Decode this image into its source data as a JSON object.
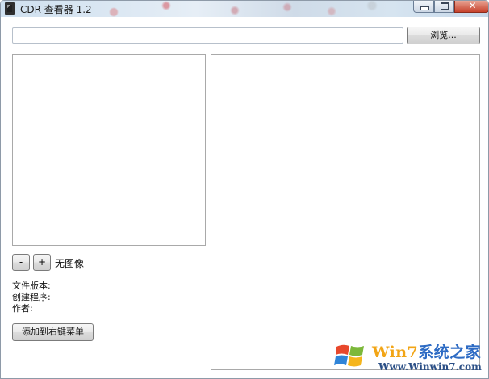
{
  "window": {
    "title": "CDR 查看器 1.2",
    "icon": "cdr-app-icon",
    "controls": {
      "minimize": "minimize-icon",
      "maximize": "maximize-icon",
      "close_glyph": "✕"
    }
  },
  "toolbar": {
    "path_value": "",
    "path_placeholder": "",
    "browse_label": "浏览..."
  },
  "preview": {
    "zoom_out_label": "-",
    "zoom_in_label": "+",
    "status_text": "无图像"
  },
  "info": {
    "file_version_label": "文件版本:",
    "creator_label": "创建程序:",
    "author_label": "作者:"
  },
  "actions": {
    "add_context_menu_label": "添加到右键菜单"
  },
  "watermark": {
    "brand_part1": "Win7",
    "brand_part2": "系统之家",
    "url": "Www.Winwin7.com"
  },
  "colors": {
    "titlebar": "#d6e4f0",
    "close_button": "#c7422c",
    "panel_border": "#a9a9a9",
    "watermark_orange": "#f2a516",
    "watermark_blue": "#2d6bc4"
  }
}
